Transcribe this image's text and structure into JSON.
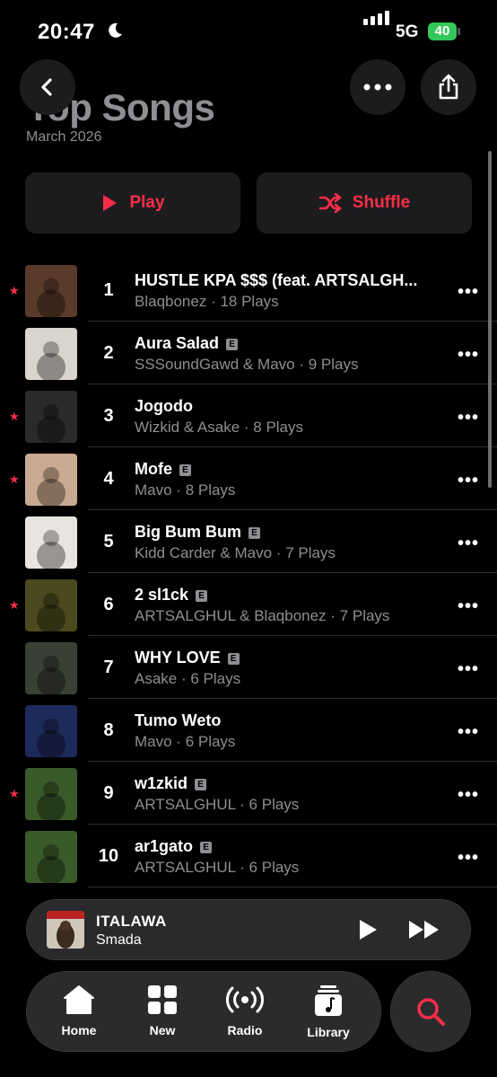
{
  "status": {
    "time": "20:47",
    "network": "5G",
    "battery": "40"
  },
  "header": {
    "title": "Top Songs",
    "subtitle": "March 2026"
  },
  "actions": {
    "play": "Play",
    "shuffle": "Shuffle"
  },
  "songs": [
    {
      "rank": "1",
      "title": "HUSTLE KPA $$$ (feat. ARTSALGH...",
      "explicit": false,
      "artist": "Blaqbonez",
      "plays": "18 Plays",
      "favorite": true,
      "art_color": "#5a3a2a"
    },
    {
      "rank": "2",
      "title": "Aura Salad",
      "explicit": true,
      "artist": "SSSoundGawd & Mavo",
      "plays": "9 Plays",
      "favorite": false,
      "art_color": "#d9d4cc"
    },
    {
      "rank": "3",
      "title": "Jogodo",
      "explicit": false,
      "artist": "Wizkid & Asake",
      "plays": "8 Plays",
      "favorite": true,
      "art_color": "#2a2a2a"
    },
    {
      "rank": "4",
      "title": "Mofe",
      "explicit": true,
      "artist": "Mavo",
      "plays": "8 Plays",
      "favorite": true,
      "art_color": "#c9a98f"
    },
    {
      "rank": "5",
      "title": "Big Bum Bum",
      "explicit": true,
      "artist": "Kidd Carder & Mavo",
      "plays": "7 Plays",
      "favorite": false,
      "art_color": "#e8e4e0"
    },
    {
      "rank": "6",
      "title": "2 sl1ck",
      "explicit": true,
      "artist": "ARTSALGHUL & Blaqbonez",
      "plays": "7 Plays",
      "favorite": true,
      "art_color": "#4a4a1e"
    },
    {
      "rank": "7",
      "title": "WHY LOVE",
      "explicit": true,
      "artist": "Asake",
      "plays": "6 Plays",
      "favorite": false,
      "art_color": "#3a4034"
    },
    {
      "rank": "8",
      "title": "Tumo Weto",
      "explicit": false,
      "artist": "Mavo",
      "plays": "6 Plays",
      "favorite": false,
      "art_color": "#1e2a5a"
    },
    {
      "rank": "9",
      "title": "w1zkid",
      "explicit": true,
      "artist": "ARTSALGHUL",
      "plays": "6 Plays",
      "favorite": true,
      "art_color": "#3a5a2a"
    },
    {
      "rank": "10",
      "title": "ar1gato",
      "explicit": true,
      "artist": "ARTSALGHUL",
      "plays": "6 Plays",
      "favorite": false,
      "art_color": "#3a5a2a"
    }
  ],
  "now_playing": {
    "title": "ITALAWA",
    "artist": "Smada"
  },
  "tabs": [
    {
      "label": "Home",
      "icon": "house-icon"
    },
    {
      "label": "New",
      "icon": "grid-icon"
    },
    {
      "label": "Radio",
      "icon": "radio-icon"
    },
    {
      "label": "Library",
      "icon": "library-icon"
    }
  ],
  "colors": {
    "accent": "#fa2d48",
    "background": "#000000",
    "surface": "#1c1c1e"
  }
}
